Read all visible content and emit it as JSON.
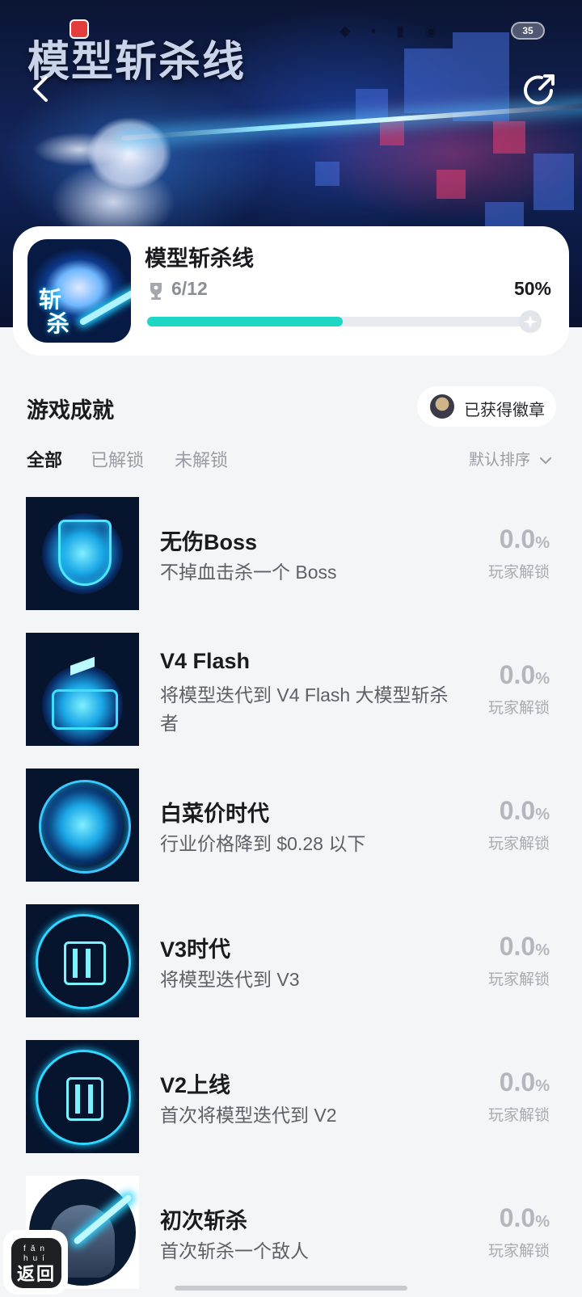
{
  "banner": {
    "title": "模型斩杀线",
    "battery_level": "35"
  },
  "game": {
    "name": "模型斩杀线",
    "progress_text": "6/12",
    "percent_text": "50%",
    "progress_fraction": 0.5
  },
  "section": {
    "title": "游戏成就",
    "badge_label": "已获得徽章"
  },
  "tabs": [
    {
      "label": "全部",
      "active": true
    },
    {
      "label": "已解锁",
      "active": false
    },
    {
      "label": "未解锁",
      "active": false
    }
  ],
  "sort_label": "默认排序",
  "achievements": [
    {
      "title": "无伤Boss",
      "desc": "不掉血击杀一个 Boss",
      "pct": "0.0",
      "pct_unit": "%",
      "unlock_label": "玩家解锁",
      "icon": "shield-icon"
    },
    {
      "title": "V4 Flash",
      "desc": "将模型迭代到 V4 Flash 大模型斩杀者",
      "pct": "0.0",
      "pct_unit": "%",
      "unlock_label": "玩家解锁",
      "icon": "lightning-chip-icon"
    },
    {
      "title": "白菜价时代",
      "desc": "行业价格降到 $0.28 以下",
      "pct": "0.0",
      "pct_unit": "%",
      "unlock_label": "玩家解锁",
      "icon": "cabbage-circuit-icon"
    },
    {
      "title": "V3时代",
      "desc": "将模型迭代到 V3",
      "pct": "0.0",
      "pct_unit": "%",
      "unlock_label": "玩家解锁",
      "icon": "chip-three-bars-icon"
    },
    {
      "title": "V2上线",
      "desc": "首次将模型迭代到 V2",
      "pct": "0.0",
      "pct_unit": "%",
      "unlock_label": "玩家解锁",
      "icon": "chip-two-bars-icon"
    },
    {
      "title": "初次斩杀",
      "desc": "首次斩杀一个敌人",
      "pct": "0.0",
      "pct_unit": "%",
      "unlock_label": "玩家解锁",
      "icon": "robot-sword-icon"
    }
  ],
  "return_button": {
    "pinyin_left": "fǎn",
    "pinyin_right": "huí",
    "label": "返回"
  }
}
